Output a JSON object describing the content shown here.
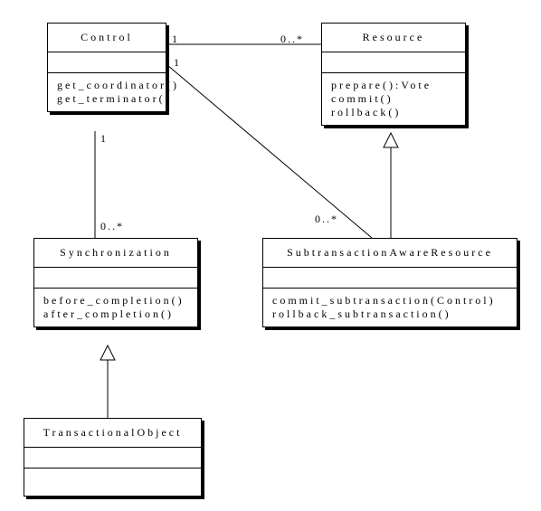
{
  "chart_data": {
    "type": "uml_class_diagram",
    "classes": [
      {
        "id": "Control",
        "name": "Control",
        "attributes": [],
        "methods": [
          "get_coordinator()",
          "get_terminator()"
        ]
      },
      {
        "id": "Resource",
        "name": "Resource",
        "attributes": [],
        "methods": [
          "prepare():Vote",
          "commit()",
          "rollback()"
        ]
      },
      {
        "id": "Synchronization",
        "name": "Synchronization",
        "attributes": [],
        "methods": [
          "before_completion()",
          "after_completion()"
        ]
      },
      {
        "id": "SubtransactionAwareResource",
        "name": "SubtransactionAwareResource",
        "attributes": [],
        "methods": [
          "commit_subtransaction(Control)",
          "rollback_subtransaction()"
        ]
      },
      {
        "id": "TransactionalObject",
        "name": "TransactionalObject",
        "attributes": [],
        "methods": []
      }
    ],
    "relationships": [
      {
        "type": "association",
        "from": "Control",
        "to": "Resource",
        "from_mult": "1",
        "to_mult": "0..*"
      },
      {
        "type": "association",
        "from": "Control",
        "to": "Synchronization",
        "from_mult": "1",
        "to_mult": "0..*"
      },
      {
        "type": "association",
        "from": "Control",
        "to": "SubtransactionAwareResource",
        "from_mult": "1",
        "to_mult": "0..*"
      },
      {
        "type": "generalization",
        "from": "SubtransactionAwareResource",
        "to": "Resource"
      },
      {
        "type": "generalization",
        "from": "TransactionalObject",
        "to": "Synchronization"
      }
    ]
  },
  "labels": {
    "control": "Control",
    "resource": "Resource",
    "sync": "Synchronization",
    "subres": "SubtransactionAwareResource",
    "tobj": "TransactionalObject",
    "get_coordinator": "get_coordinator()",
    "get_terminator": "get_terminator()",
    "prepare": "prepare():Vote",
    "commit": "commit()",
    "rollback": "rollback()",
    "before_completion": "before_completion()",
    "after_completion": "after_completion()",
    "commit_sub": "commit_subtransaction(Control)",
    "rollback_sub": "rollback_subtransaction()",
    "one": "1",
    "many": "0..*"
  }
}
